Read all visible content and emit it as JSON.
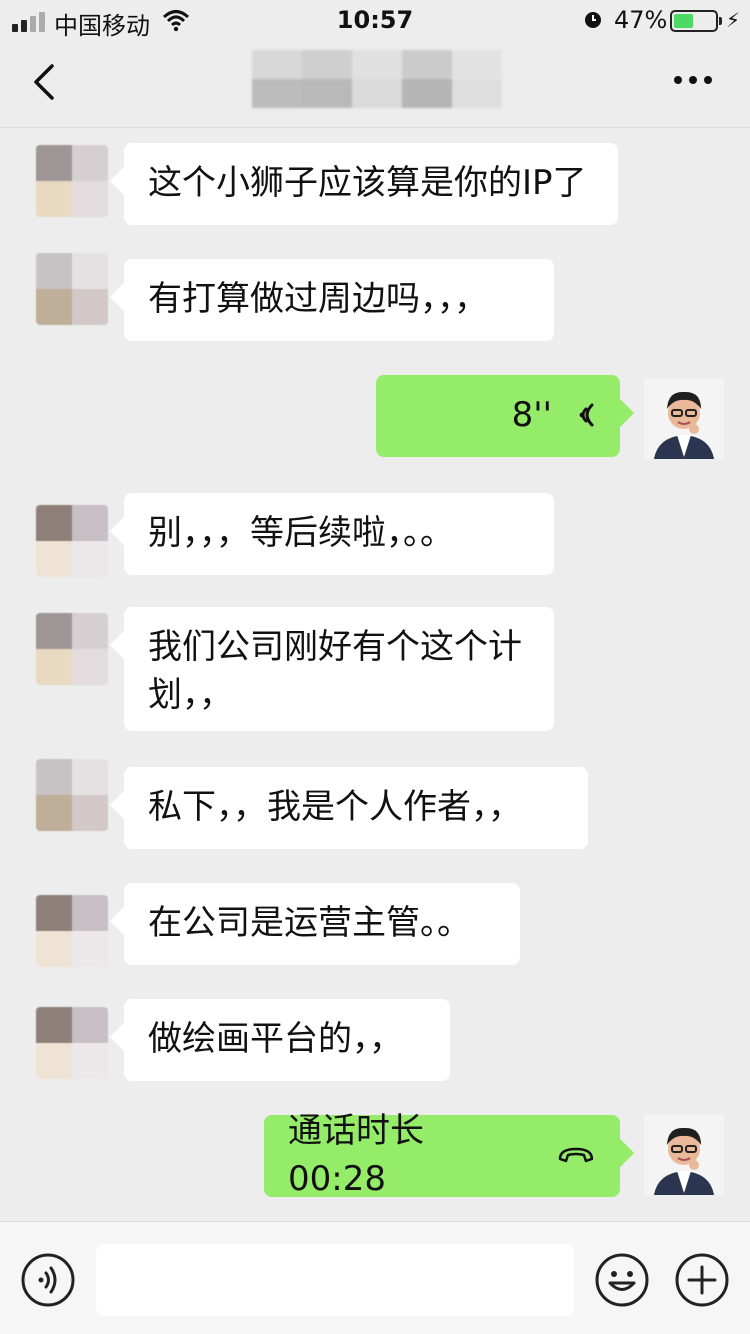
{
  "status_bar": {
    "carrier": "中国移动",
    "time": "10:57",
    "battery_percent": "47%",
    "battery_level": 0.47,
    "icons": [
      "signal-icon",
      "wifi-icon",
      "alarm-icon",
      "battery-icon",
      "charging-icon"
    ]
  },
  "nav": {
    "back_icon": "chevron-left-icon",
    "more_icon": "more-dots-icon"
  },
  "messages": [
    {
      "side": "left",
      "type": "text",
      "lines": [
        "这个小狮子应该算是你的IP了"
      ]
    },
    {
      "side": "left",
      "type": "text",
      "lines": [
        "有打算做过周边吗，，，"
      ]
    },
    {
      "side": "right",
      "type": "voice",
      "duration": "8''"
    },
    {
      "side": "left",
      "type": "text",
      "lines": [
        "别，，，等后续啦，。。"
      ]
    },
    {
      "side": "left",
      "type": "text",
      "lines": [
        "我们公司刚好有个这个计",
        "划，，"
      ]
    },
    {
      "side": "left",
      "type": "text",
      "lines": [
        "私下，，我是个人作者，，"
      ]
    },
    {
      "side": "left",
      "type": "text",
      "lines": [
        "在公司是运营主管。。"
      ]
    },
    {
      "side": "left",
      "type": "text",
      "lines": [
        "做绘画平台的，，"
      ]
    },
    {
      "side": "right",
      "type": "call",
      "text": "通话时长 00:28"
    }
  ],
  "input_bar": {
    "voice_icon": "voice-input-icon",
    "emoji_icon": "emoji-icon",
    "plus_icon": "plus-icon",
    "message_value": ""
  },
  "colors": {
    "background": "#ededed",
    "bubble_right": "#95ec69",
    "bubble_left": "#ffffff",
    "battery_fill": "#4cd964"
  }
}
